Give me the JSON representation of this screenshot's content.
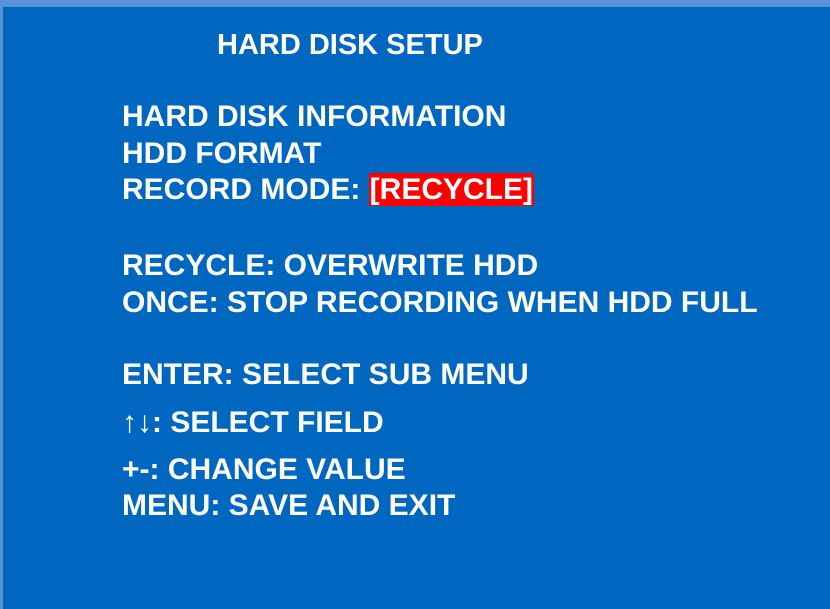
{
  "title": "HARD DISK SETUP",
  "menu": {
    "hdd_info": "HARD DISK INFORMATION",
    "hdd_format": "HDD FORMAT",
    "record_mode_label": "RECORD MODE: ",
    "record_mode_value": "[RECYCLE]"
  },
  "descriptions": {
    "recycle": "RECYCLE: OVERWRITE HDD",
    "once": "ONCE: STOP RECORDING WHEN HDD FULL"
  },
  "help": {
    "enter": "ENTER: SELECT SUB MENU",
    "arrows_symbol": "↑↓",
    "select_field": ": SELECT FIELD",
    "change_value": "+-: CHANGE VALUE",
    "save_exit": "MENU: SAVE AND EXIT"
  },
  "colors": {
    "background": "#0067c1",
    "border": "#5a94d6",
    "highlight": "#ff0000",
    "text": "#ffffff"
  }
}
